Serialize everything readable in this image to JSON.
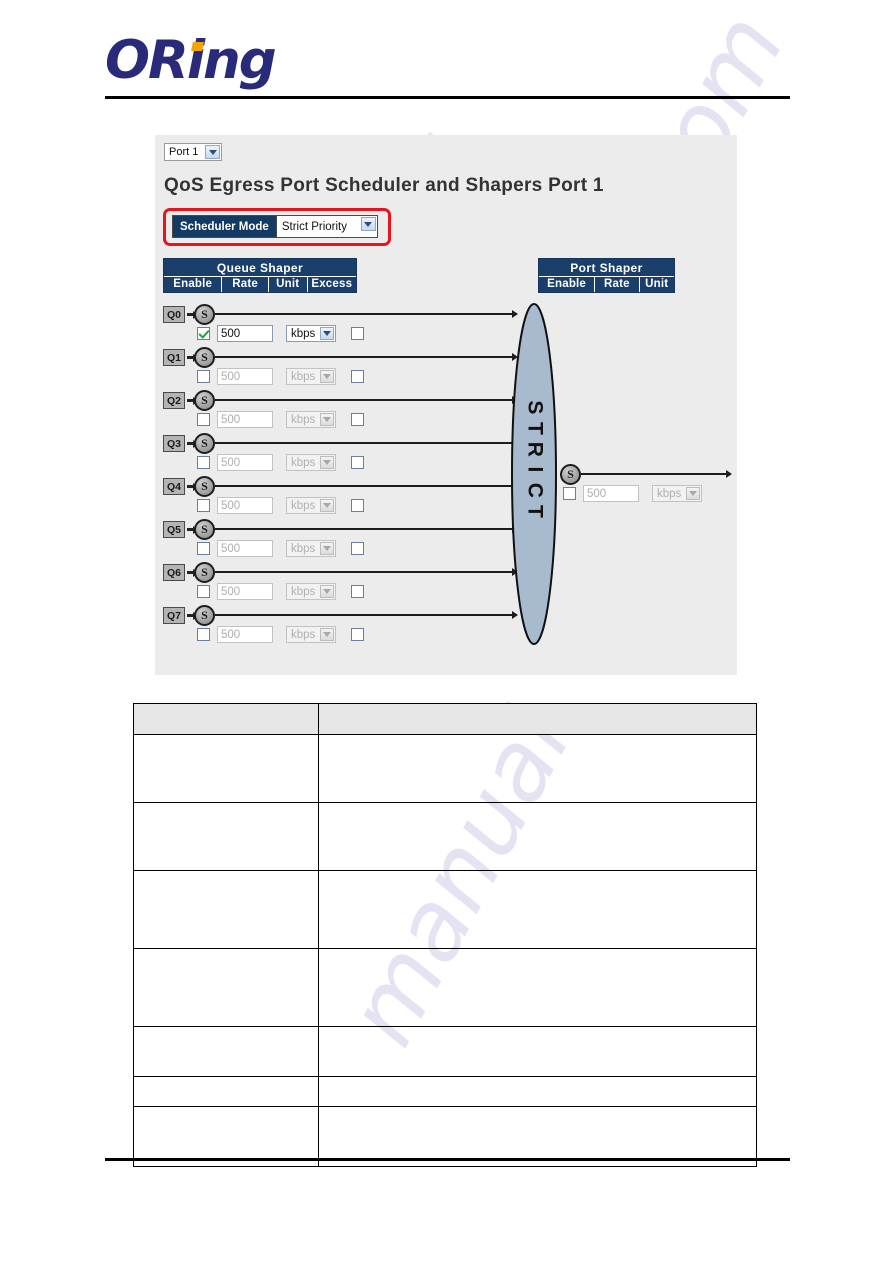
{
  "brand": {
    "logo_text": "ORing"
  },
  "panel": {
    "port_selector": {
      "value": "Port 1",
      "arrow_icon": "chevron-down-icon"
    },
    "title": "QoS Egress Port Scheduler and Shapers  Port 1",
    "scheduler_mode": {
      "label": "Scheduler Mode",
      "value": "Strict Priority",
      "arrow_icon": "chevron-down-icon",
      "highlight_color": "#e8141c"
    },
    "queue_shaper_header": {
      "title": "Queue Shaper",
      "columns": [
        "Enable",
        "Rate",
        "Unit",
        "Excess"
      ]
    },
    "port_shaper_header": {
      "title": "Port Shaper",
      "columns": [
        "Enable",
        "Rate",
        "Unit"
      ]
    },
    "scheduler_node_label": "S",
    "strict_label": "STRICT",
    "strict_letters": [
      "S",
      "T",
      "R",
      "I",
      "C",
      "T"
    ],
    "queues": [
      {
        "label": "Q0",
        "enabled": true,
        "rate": "500",
        "unit": "kbps",
        "excess": false
      },
      {
        "label": "Q1",
        "enabled": false,
        "rate": "500",
        "unit": "kbps",
        "excess": false
      },
      {
        "label": "Q2",
        "enabled": false,
        "rate": "500",
        "unit": "kbps",
        "excess": false
      },
      {
        "label": "Q3",
        "enabled": false,
        "rate": "500",
        "unit": "kbps",
        "excess": false
      },
      {
        "label": "Q4",
        "enabled": false,
        "rate": "500",
        "unit": "kbps",
        "excess": false
      },
      {
        "label": "Q5",
        "enabled": false,
        "rate": "500",
        "unit": "kbps",
        "excess": false
      },
      {
        "label": "Q6",
        "enabled": false,
        "rate": "500",
        "unit": "kbps",
        "excess": false
      },
      {
        "label": "Q7",
        "enabled": false,
        "rate": "500",
        "unit": "kbps",
        "excess": false
      }
    ],
    "port_shaper": {
      "enabled": false,
      "rate": "500",
      "unit": "kbps"
    },
    "colors": {
      "panel_background": "#ececec",
      "header_bar": "#1b3f6b",
      "scheduler_label_bar": "#123a63",
      "ellipse_fill": "#a8bace",
      "queue_box": "#b4b4b4",
      "check_green": "#23a03a"
    }
  },
  "description_table": {
    "header": [
      "",
      ""
    ],
    "rows": [
      [
        "",
        ""
      ],
      [
        "",
        ""
      ],
      [
        "",
        ""
      ],
      [
        "",
        ""
      ],
      [
        "",
        ""
      ],
      [
        "",
        ""
      ],
      [
        "",
        ""
      ]
    ]
  },
  "watermark": {
    "text": "manualshive.com",
    "fragments": [
      "manuals",
      "ive.com",
      "manual"
    ]
  }
}
